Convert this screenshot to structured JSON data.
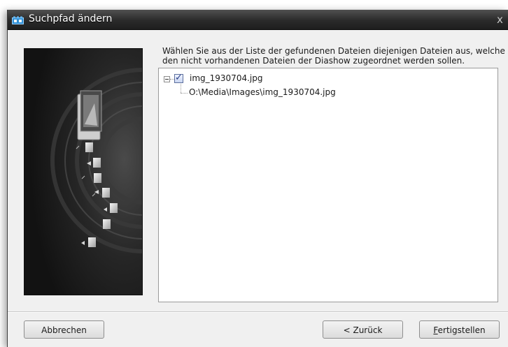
{
  "window": {
    "title": "Suchpfad ändern",
    "close_glyph": "x"
  },
  "instruction": "Wählen Sie aus der Liste der gefundenen Dateien diejenigen Dateien aus, welche den nicht vorhandenen Dateien der Diashow zugeordnet werden sollen.",
  "file_list": {
    "items": [
      {
        "name": "img_1930704.jpg",
        "checked": true,
        "expanded": true,
        "path": "O:\\Media\\Images\\img_1930704.jpg"
      }
    ]
  },
  "buttons": {
    "cancel": "Abbrechen",
    "back": "< Zurück",
    "finish_mnemonic": "F",
    "finish_rest": "ertigstellen"
  },
  "icons": {
    "app": "slideshow-app-icon",
    "close": "close-icon",
    "expander": "tree-collapse-icon",
    "checkbox": "checkbox-checked-icon",
    "illustration": "folder-tree-illustration"
  },
  "colors": {
    "titlebar": "#2a2a2a",
    "dialog_background": "#f0f0f0",
    "panel_background": "#1a1a1a",
    "checkmark": "#2a3f86"
  }
}
